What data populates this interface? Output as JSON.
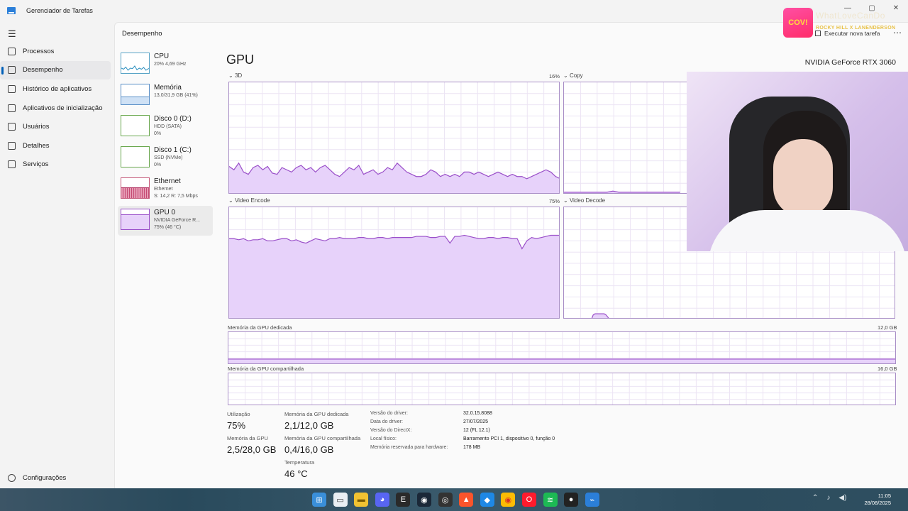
{
  "window": {
    "title": "Gerenciador de Tarefas",
    "controls": [
      "—",
      "▢",
      "✕"
    ]
  },
  "sidebar": {
    "items": [
      {
        "label": "Processos",
        "icon": "processes-icon"
      },
      {
        "label": "Desempenho",
        "icon": "performance-icon"
      },
      {
        "label": "Histórico de aplicativos",
        "icon": "history-icon"
      },
      {
        "label": "Aplicativos de inicialização",
        "icon": "startup-icon"
      },
      {
        "label": "Usuários",
        "icon": "users-icon"
      },
      {
        "label": "Detalhes",
        "icon": "details-icon"
      },
      {
        "label": "Serviços",
        "icon": "services-icon"
      }
    ],
    "settings": "Configurações",
    "active": "Desempenho"
  },
  "header": {
    "title": "Desempenho",
    "run_task": "Executar nova tarefa"
  },
  "resources": [
    {
      "name": "CPU",
      "line1": "20% 4,69 GHz",
      "line2": ""
    },
    {
      "name": "Memória",
      "line1": "13,0/31,9 GB (41%)",
      "line2": ""
    },
    {
      "name": "Disco 0 (D:)",
      "line1": "HDD (SATA)",
      "line2": "0%"
    },
    {
      "name": "Disco 1 (C:)",
      "line1": "SSD (NVMe)",
      "line2": "0%"
    },
    {
      "name": "Ethernet",
      "line1": "Ethernet",
      "line2": "S: 14,2 R: 7,5 Mbps"
    },
    {
      "name": "GPU 0",
      "line1": "NVIDIA GeForce R...",
      "line2": "75% (46 °C)"
    }
  ],
  "gpu": {
    "title": "GPU",
    "model": "NVIDIA GeForce RTX 3060",
    "engines": [
      {
        "label": "3D",
        "pct": "16%",
        "values": [
          0.25,
          0.22,
          0.28,
          0.2,
          0.18,
          0.24,
          0.26,
          0.22,
          0.25,
          0.19,
          0.18,
          0.24,
          0.22,
          0.2,
          0.24,
          0.26,
          0.22,
          0.24,
          0.2,
          0.24,
          0.26,
          0.22,
          0.18,
          0.16,
          0.2,
          0.24,
          0.22,
          0.26,
          0.18,
          0.2,
          0.22,
          0.18,
          0.2,
          0.24,
          0.22,
          0.28,
          0.24,
          0.2,
          0.18,
          0.16,
          0.16,
          0.18,
          0.22,
          0.2,
          0.16,
          0.18,
          0.16,
          0.18,
          0.16,
          0.2,
          0.2,
          0.18,
          0.2,
          0.18,
          0.16,
          0.18,
          0.2,
          0.18,
          0.16,
          0.18,
          0.16,
          0.16,
          0.14,
          0.16,
          0.18,
          0.2,
          0.22,
          0.2,
          0.16,
          0.14
        ]
      },
      {
        "label": "Copy",
        "pct": "",
        "values": [
          0.02,
          0.02,
          0.02,
          0.02,
          0.02,
          0.02,
          0.02,
          0.02,
          0.03,
          0.02,
          0.02,
          0.02,
          0.02,
          0.02,
          0.02,
          0.02,
          0.02,
          0.02,
          0.02,
          0.02
        ]
      },
      {
        "label": "Video Encode",
        "pct": "75%",
        "values": [
          0.72,
          0.72,
          0.71,
          0.72,
          0.7,
          0.71,
          0.71,
          0.72,
          0.7,
          0.7,
          0.71,
          0.72,
          0.72,
          0.7,
          0.71,
          0.69,
          0.68,
          0.7,
          0.72,
          0.71,
          0.7,
          0.72,
          0.72,
          0.73,
          0.72,
          0.72,
          0.72,
          0.73,
          0.73,
          0.72,
          0.72,
          0.73,
          0.73,
          0.72,
          0.73,
          0.73,
          0.73,
          0.73,
          0.73,
          0.74,
          0.74,
          0.74,
          0.73,
          0.73,
          0.74,
          0.74,
          0.68,
          0.74,
          0.74,
          0.75,
          0.74,
          0.73,
          0.72,
          0.72,
          0.73,
          0.73,
          0.72,
          0.73,
          0.73,
          0.72,
          0.72,
          0.63,
          0.7,
          0.73,
          0.72,
          0.73,
          0.74,
          0.75,
          0.75,
          0.75
        ]
      },
      {
        "label": "Video Decode",
        "pct": "",
        "values": [
          0,
          0,
          0,
          0,
          0,
          0,
          0,
          0,
          0,
          0,
          0,
          0,
          0,
          0,
          0,
          0,
          0.04,
          0.05,
          0.05,
          0.05,
          0.05,
          0.05,
          0.05,
          0.04,
          0.02,
          0,
          0,
          0,
          0,
          0,
          0,
          0,
          0,
          0,
          0,
          0,
          0,
          0,
          0,
          0,
          0,
          0,
          0,
          0,
          0,
          0,
          0,
          0,
          0,
          0,
          0,
          0,
          0,
          0,
          0,
          0,
          0,
          0,
          0,
          0,
          0,
          0,
          0,
          0,
          0,
          0,
          0,
          0,
          0,
          0
        ]
      }
    ],
    "dedicated": {
      "label": "Memória da GPU dedicada",
      "max": "12,0 GB",
      "used_fraction": 0.175
    },
    "shared": {
      "label": "Memória da GPU compartilhada",
      "max": "16,0 GB",
      "used_fraction": 0.025
    },
    "stats": {
      "util_label": "Utilização",
      "util_value": "75%",
      "ded_label": "Memória da GPU dedicada",
      "ded_value": "2,1/12,0 GB",
      "gpumem_label": "Memória da GPU",
      "gpumem_value": "2,5/28,0 GB",
      "shared_label": "Memória da GPU compartilhada",
      "shared_value": "0,4/16,0 GB",
      "temp_label": "Temperatura",
      "temp_value": "46 °C"
    },
    "details": [
      {
        "key": "Versão do driver:",
        "value": "32.0.15.8088"
      },
      {
        "key": "Data do driver:",
        "value": "27/07/2025"
      },
      {
        "key": "Versão do DirectX:",
        "value": "12 (FL 12.1)"
      },
      {
        "key": "Local físico:",
        "value": "Barramento PCI 1, dispositivo 0, função 0"
      },
      {
        "key": "Memória reservada para hardware:",
        "value": "178 MB"
      }
    ]
  },
  "overlay": {
    "badge": "COV!",
    "text": "WhatLoveCanDo",
    "sub": "ROCKY HILL X LANENDERSON"
  },
  "taskbar": {
    "icons": [
      "windows-start-icon",
      "file-icon",
      "folder-icon",
      "discord-icon",
      "epic-games-icon",
      "steam-icon",
      "obs-icon",
      "brave-icon",
      "app-icon",
      "chrome-icon",
      "opera-icon",
      "spotify-icon",
      "recorder-icon",
      "task-manager-icon"
    ],
    "time": "11:05",
    "date": "28/08/2025"
  },
  "colors": {
    "graph_line": "#9a4fc9",
    "graph_fill": "#e7d2fa",
    "graph_border": "#a98fc7",
    "accent": "#005fb8"
  }
}
